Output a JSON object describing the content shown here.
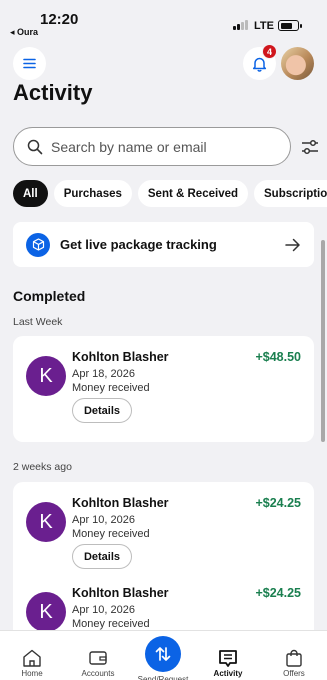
{
  "status_bar": {
    "time": "12:20",
    "back_app": "◂ Oura",
    "network": "LTE",
    "battery_level": 0.6
  },
  "header": {
    "menu_icon": "hamburger-icon",
    "notification_icon": "bell-icon",
    "notification_count": "4",
    "title": "Activity"
  },
  "search": {
    "placeholder": "Search by name or email",
    "value": ""
  },
  "filters": [
    {
      "label": "All",
      "active": true
    },
    {
      "label": "Purchases",
      "active": false
    },
    {
      "label": "Sent & Received",
      "active": false
    },
    {
      "label": "Subscriptions",
      "active": false
    }
  ],
  "tracking": {
    "label": "Get live package tracking",
    "icon": "package-icon"
  },
  "completed": {
    "title": "Completed",
    "groups": [
      {
        "label": "Last Week",
        "transactions": [
          {
            "initial": "K",
            "name": "Kohlton Blasher",
            "date": "Apr 18, 2026",
            "type": "Money received",
            "amount": "+$48.50",
            "details_label": "Details"
          }
        ]
      },
      {
        "label": "2 weeks ago",
        "transactions": [
          {
            "initial": "K",
            "name": "Kohlton Blasher",
            "date": "Apr 10, 2026",
            "type": "Money received",
            "amount": "+$24.25",
            "details_label": "Details"
          },
          {
            "initial": "K",
            "name": "Kohlton Blasher",
            "date": "Apr 10, 2026",
            "type": "Money received",
            "amount": "+$24.25"
          }
        ]
      }
    ]
  },
  "tabbar": {
    "home": "Home",
    "accounts": "Accounts",
    "send_request": "Send/Request",
    "activity": "Activity",
    "offers": "Offers",
    "active_tab": "activity",
    "accent_color": "#0b63e5"
  }
}
